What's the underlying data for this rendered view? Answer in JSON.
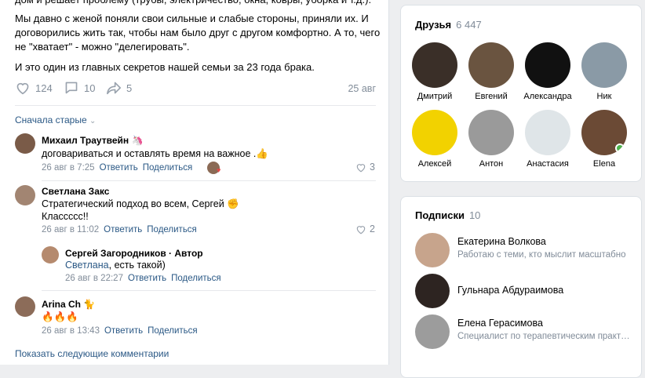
{
  "post": {
    "line0": "дом и решает проблему (трубы, электричество, окна, ковры, уборка и т.д.).",
    "para1": "Мы давно с женой поняли свои сильные и слабые стороны, приняли их. И договорились жить так, чтобы нам было друг с другом комфортно. А то, чего не \"хватает\" - можно \"делегировать\".",
    "para2": "И это один из главных секретов нашей семьи за 23 года брака.",
    "likes": "124",
    "comments": "10",
    "shares": "5",
    "date": "25 авг"
  },
  "comments_sort": "Сначала старые",
  "comments": [
    {
      "author": "Михаил Траутвейн",
      "badge": "🦄",
      "text": "договариваться и оставлять время на важное .👍",
      "date": "26 авг в 7:25",
      "reply": "Ответить",
      "share": "Поделиться",
      "likes": "3"
    },
    {
      "author": "Светлана Закс",
      "text": "Стратегический подход во всем, Сергей ✊",
      "text2": "Классссс!!",
      "date": "26 авг в 11:02",
      "reply": "Ответить",
      "share": "Поделиться",
      "likes": "2"
    },
    {
      "author": "Сергей Загородников · Автор",
      "mention": "Светлана",
      "text": ", есть такой)",
      "date": "26 авг в 22:27",
      "reply": "Ответить",
      "share": "Поделиться"
    },
    {
      "author": "Arina Ch",
      "badge": "🐈",
      "text": "🔥🔥🔥",
      "date": "26 авг в 13:43",
      "reply": "Ответить",
      "share": "Поделиться"
    }
  ],
  "show_more": "Показать следующие комментарии",
  "friends": {
    "title": "Друзья",
    "count": "6 447",
    "items": [
      {
        "name": "Дмитрий",
        "color": "#3a2f28"
      },
      {
        "name": "Евгений",
        "color": "#6a5440"
      },
      {
        "name": "Александра",
        "color": "#111111"
      },
      {
        "name": "Ник",
        "color": "#8a9aa6"
      },
      {
        "name": "Алексей",
        "color": "#f2d200"
      },
      {
        "name": "Антон",
        "color": "#9a9a9a"
      },
      {
        "name": "Анастасия",
        "color": "#dfe5e8"
      },
      {
        "name": "Elena",
        "color": "#6b4a35"
      }
    ]
  },
  "subscriptions": {
    "title": "Подписки",
    "count": "10",
    "items": [
      {
        "name": "Екатерина Волкова",
        "desc": "Работаю с теми, кто мыслит масштабно",
        "color": "#c7a48c"
      },
      {
        "name": "Гульнара Абдураимова",
        "desc": "",
        "color": "#2d2421"
      },
      {
        "name": "Елена Герасимова",
        "desc": "Специалист по терапевтическим практикам",
        "color": "#9c9c9c"
      }
    ]
  }
}
